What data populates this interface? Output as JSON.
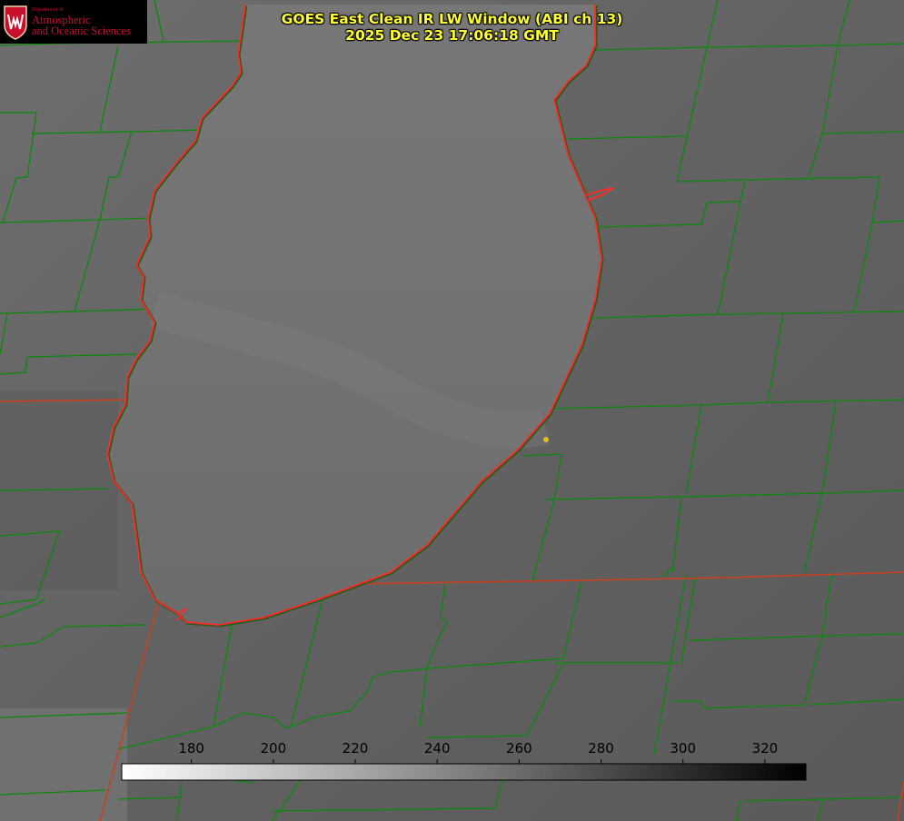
{
  "logo": {
    "dept": "Department of",
    "line1": "Atmospheric",
    "line2": "and Oceanic Sciences",
    "seal_color": "#c8102e"
  },
  "title": {
    "line1": "GOES East Clean IR LW Window (ABI ch 13)",
    "line2": "2025 Dec 23 17:06:18 GMT",
    "color": "#ffff33"
  },
  "colorbar": {
    "ticks": [
      "180",
      "200",
      "220",
      "240",
      "260",
      "280",
      "300",
      "320"
    ],
    "min": 163,
    "max": 330,
    "gradient": [
      "#ffffff",
      "#000000"
    ]
  },
  "colors": {
    "county_lines": "#0a8a0a",
    "state_lines": "#c8401e",
    "coastline": "#ff2a2a",
    "marker": "#e0c020"
  }
}
